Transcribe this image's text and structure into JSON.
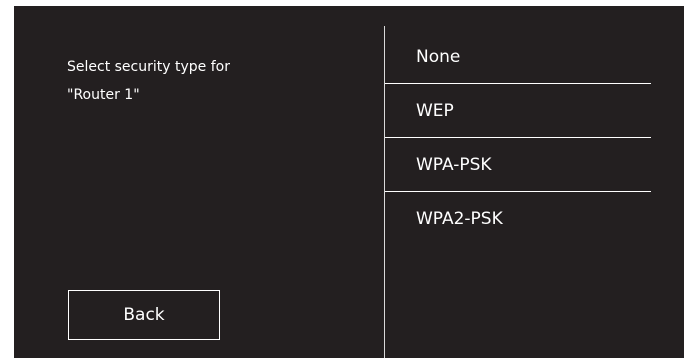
{
  "prompt": {
    "line1": "Select security type for",
    "line2": "\"Router 1\""
  },
  "back_button": {
    "label": "Back"
  },
  "security_options": [
    {
      "label": "None"
    },
    {
      "label": "WEP"
    },
    {
      "label": "WPA-PSK"
    },
    {
      "label": "WPA2-PSK"
    }
  ],
  "colors": {
    "background": "#231f20",
    "text": "#ffffff",
    "divider": "#d9d9d9"
  }
}
